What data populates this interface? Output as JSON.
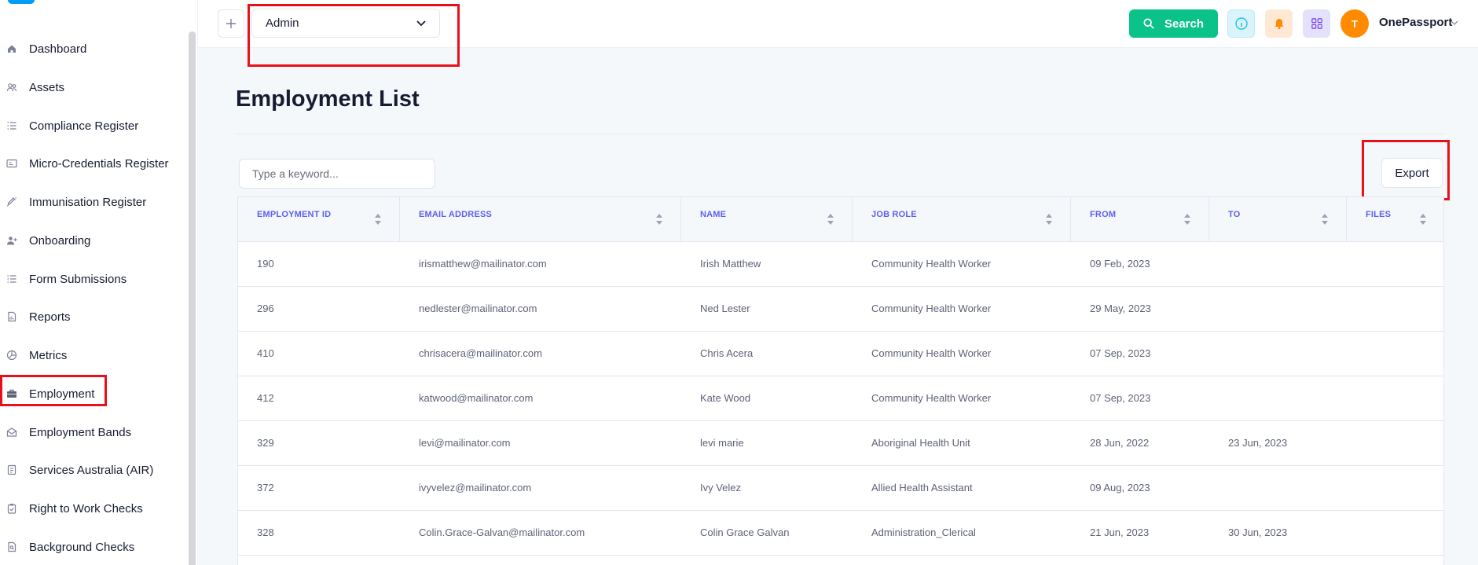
{
  "sidebar": {
    "items": [
      {
        "label": "Dashboard",
        "icon": "home-icon"
      },
      {
        "label": "Assets",
        "icon": "users-icon"
      },
      {
        "label": "Compliance Register",
        "icon": "list-icon"
      },
      {
        "label": "Micro-Credentials Register",
        "icon": "id-card-icon"
      },
      {
        "label": "Immunisation Register",
        "icon": "syringe-icon"
      },
      {
        "label": "Onboarding",
        "icon": "user-plus-icon"
      },
      {
        "label": "Form Submissions",
        "icon": "list-icon"
      },
      {
        "label": "Reports",
        "icon": "document-chart-icon"
      },
      {
        "label": "Metrics",
        "icon": "pie-chart-icon"
      },
      {
        "label": "Employment",
        "icon": "briefcase-icon"
      },
      {
        "label": "Employment Bands",
        "icon": "envelope-open-icon"
      },
      {
        "label": "Services Australia (AIR)",
        "icon": "badge-id-icon"
      },
      {
        "label": "Right to Work Checks",
        "icon": "clipboard-check-icon"
      },
      {
        "label": "Background Checks",
        "icon": "file-search-icon"
      }
    ]
  },
  "topbar": {
    "org_select": {
      "value": "Admin"
    },
    "search_label": "Search",
    "avatar_initial": "T",
    "user_name": "OnePassport"
  },
  "main": {
    "title": "Employment List",
    "keyword_placeholder": "Type a keyword...",
    "export_label": "Export"
  },
  "table": {
    "columns": [
      "EMPLOYMENT ID",
      "EMAIL ADDRESS",
      "NAME",
      "JOB ROLE",
      "FROM",
      "TO",
      "FILES"
    ],
    "rows": [
      {
        "id": "190",
        "email": "irismatthew@mailinator.com",
        "name": "Irish Matthew",
        "role": "Community Health Worker",
        "from": "09 Feb, 2023",
        "to": "",
        "files": ""
      },
      {
        "id": "296",
        "email": "nedlester@mailinator.com",
        "name": "Ned Lester",
        "role": "Community Health Worker",
        "from": "29 May, 2023",
        "to": "",
        "files": ""
      },
      {
        "id": "410",
        "email": "chrisacera@mailinator.com",
        "name": "Chris Acera",
        "role": "Community Health Worker",
        "from": "07 Sep, 2023",
        "to": "",
        "files": ""
      },
      {
        "id": "412",
        "email": "katwood@mailinator.com",
        "name": "Kate Wood",
        "role": "Community Health Worker",
        "from": "07 Sep, 2023",
        "to": "",
        "files": ""
      },
      {
        "id": "329",
        "email": "levi@mailinator.com",
        "name": "levi marie",
        "role": "Aboriginal Health Unit",
        "from": "28 Jun, 2022",
        "to": "23 Jun, 2023",
        "files": ""
      },
      {
        "id": "372",
        "email": "ivyvelez@mailinator.com",
        "name": "Ivy Velez",
        "role": "Allied Health Assistant",
        "from": "09 Aug, 2023",
        "to": "",
        "files": ""
      },
      {
        "id": "328",
        "email": "Colin.Grace-Galvan@mailinator.com",
        "name": "Colin Grace Galvan",
        "role": "Administration_Clerical",
        "from": "21 Jun, 2023",
        "to": "30 Jun, 2023",
        "files": ""
      }
    ]
  },
  "colors": {
    "accent": "#0bc289",
    "header_text": "#5c5fef",
    "highlight_red": "#e8101a"
  }
}
